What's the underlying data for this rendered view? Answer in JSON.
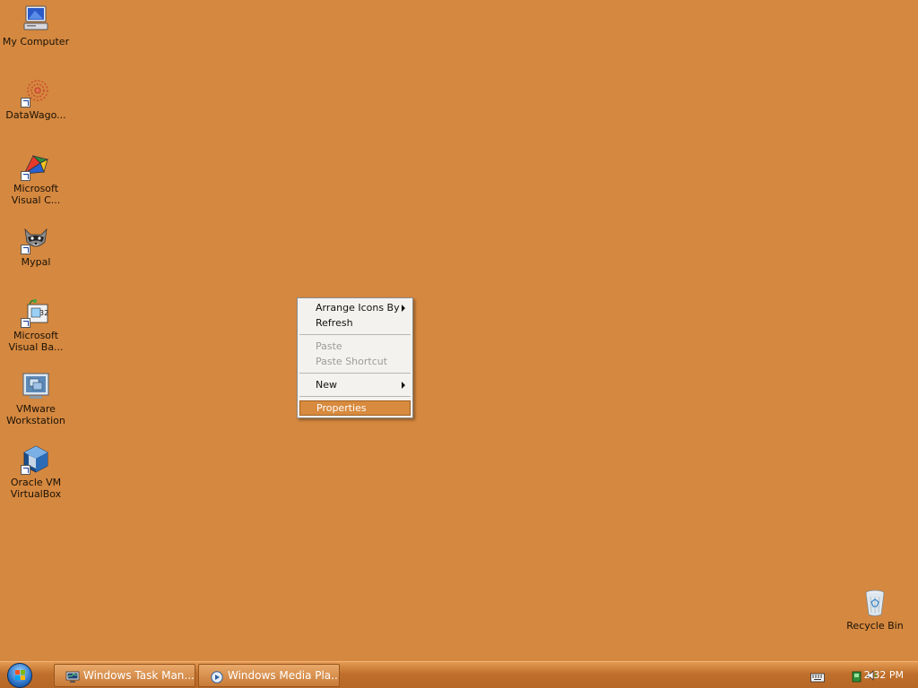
{
  "desktop": {
    "background_color": "#d5883f",
    "icons": [
      {
        "label": "My Computer",
        "icon": "computer-icon"
      },
      {
        "label": "DataWago...",
        "icon": "datawagon-icon"
      },
      {
        "label": "Microsoft Visual C...",
        "icon": "visual-c-icon"
      },
      {
        "label": "Mypal",
        "icon": "mypal-raccoon-icon"
      },
      {
        "label": "Microsoft Visual Ba...",
        "icon": "visual-basic-icon"
      },
      {
        "label": "VMware Workstation",
        "icon": "vmware-icon"
      },
      {
        "label": "Oracle VM VirtualBox",
        "icon": "virtualbox-icon"
      },
      {
        "label": "Recycle Bin",
        "icon": "recycle-bin-icon"
      }
    ]
  },
  "context_menu": {
    "items": [
      {
        "label": "Arrange Icons By",
        "submenu": true,
        "disabled": false
      },
      {
        "label": "Refresh",
        "submenu": false,
        "disabled": false
      },
      {
        "label": "Paste",
        "submenu": false,
        "disabled": true
      },
      {
        "label": "Paste Shortcut",
        "submenu": false,
        "disabled": true
      },
      {
        "label": "New",
        "submenu": true,
        "disabled": false
      },
      {
        "label": "Properties",
        "submenu": false,
        "disabled": false,
        "highlighted": true
      }
    ],
    "highlight_color": "#d88a3e"
  },
  "taskbar": {
    "start_icon": "windows-orb-icon",
    "tasks": [
      {
        "label": "Windows Task Man...",
        "icon": "task-manager-icon"
      },
      {
        "label": "Windows Media Pla...",
        "icon": "media-player-icon"
      }
    ],
    "tray": {
      "icons": [
        "keyboard-icon",
        "network-icon",
        "volume-icon"
      ],
      "clock": "2:32 PM"
    }
  }
}
